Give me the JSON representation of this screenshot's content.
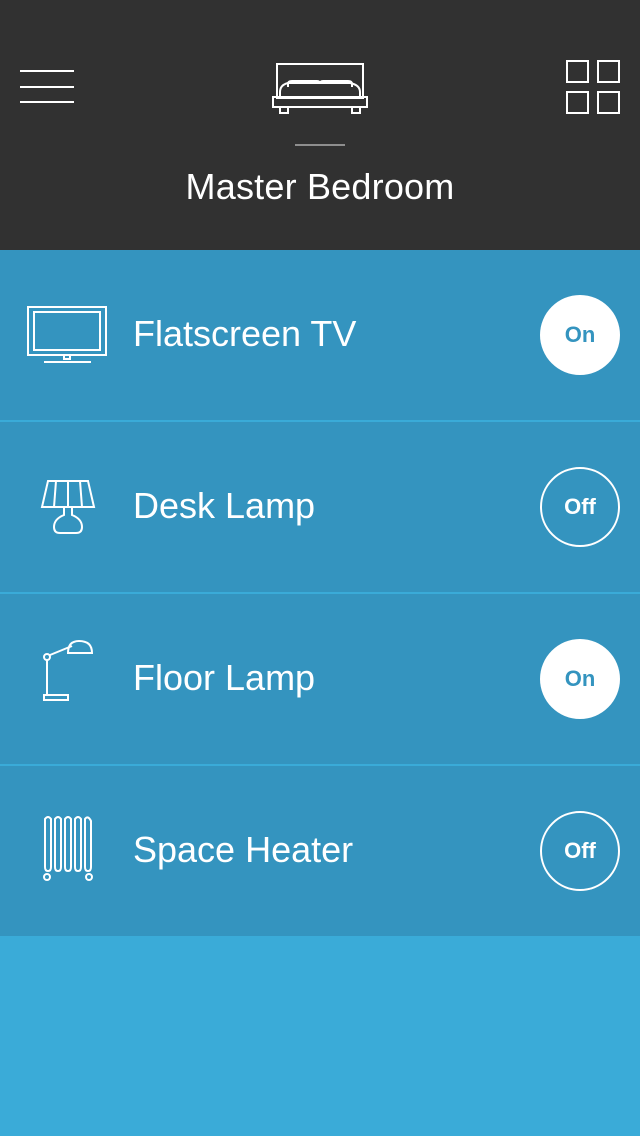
{
  "header": {
    "room_name": "Master Bedroom",
    "room_icon": "bed-icon",
    "menu_icon": "hamburger-menu-icon",
    "grid_icon": "grid-icon",
    "background": "#313131"
  },
  "devices": [
    {
      "name": "Flatscreen TV",
      "icon": "tv-icon",
      "state": "On"
    },
    {
      "name": "Desk Lamp",
      "icon": "desk-lamp-icon",
      "state": "Off"
    },
    {
      "name": "Floor Lamp",
      "icon": "floor-lamp-icon",
      "state": "On"
    },
    {
      "name": "Space Heater",
      "icon": "space-heater-icon",
      "state": "Off"
    }
  ],
  "colors": {
    "row_background": "#3494bf",
    "page_background": "#3aabd8",
    "toggle_on_background": "#ffffff",
    "toggle_on_text": "#3494bf"
  }
}
